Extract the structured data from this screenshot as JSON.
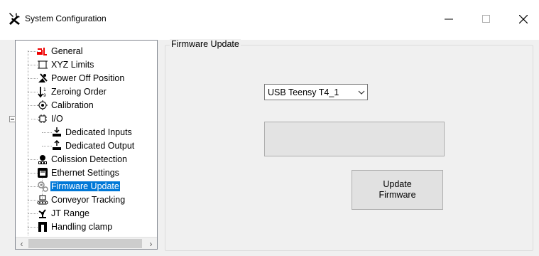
{
  "window": {
    "title": "System Configuration",
    "icons": {
      "app": "tools-icon",
      "minimize": "minimize-icon",
      "maximize": "maximize-icon",
      "close": "close-icon"
    }
  },
  "tree": {
    "items": [
      {
        "label": "General",
        "icon": "general-icon"
      },
      {
        "label": "XYZ Limits",
        "icon": "xyz-limits-icon"
      },
      {
        "label": "Power Off Position",
        "icon": "power-off-icon"
      },
      {
        "label": "Zeroing Order",
        "icon": "zeroing-order-icon"
      },
      {
        "label": "Calibration",
        "icon": "calibration-icon"
      },
      {
        "label": "I/O",
        "icon": "io-icon"
      },
      {
        "label": "Dedicated Inputs",
        "icon": "input-icon"
      },
      {
        "label": "Dedicated Output",
        "icon": "output-icon"
      },
      {
        "label": "Colission Detection",
        "icon": "collision-icon"
      },
      {
        "label": "Ethernet Settings",
        "icon": "ethernet-icon"
      },
      {
        "label": "Firmware Update",
        "icon": "gears-icon",
        "selected": true
      },
      {
        "label": "Conveyor Tracking",
        "icon": "conveyor-icon"
      },
      {
        "label": "JT Range",
        "icon": "jt-range-icon"
      },
      {
        "label": "Handling clamp",
        "icon": "clamp-icon"
      }
    ]
  },
  "firmware": {
    "group_title": "Firmware Update",
    "port_select_value": "USB Teensy T4_1",
    "update_button_label": "Update\nFirmware"
  },
  "colors": {
    "selection": "#0078d7",
    "window_bg": "#f0f0f0"
  }
}
